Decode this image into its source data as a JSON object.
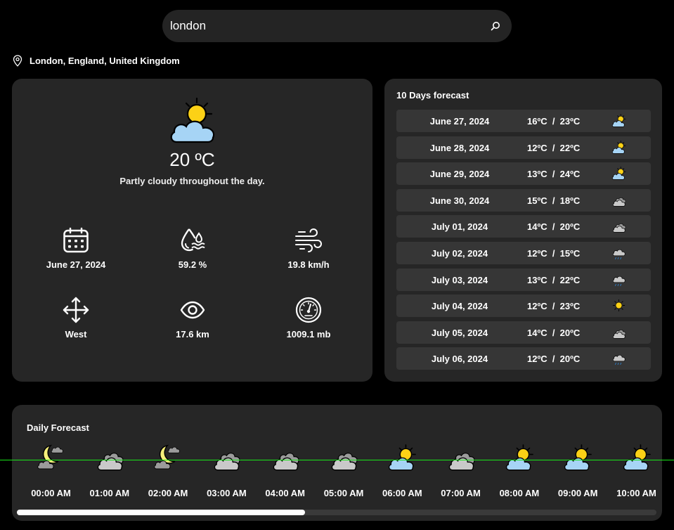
{
  "search": {
    "value": "london",
    "placeholder": ""
  },
  "location": "London, England, United Kingdom",
  "current": {
    "temp": "20 ºC",
    "summary": "Partly cloudy throughout the day.",
    "date": "June 27, 2024",
    "humidity": "59.2 %",
    "wind_speed": "19.8 km/h",
    "wind_dir": "West",
    "visibility": "17.6 km",
    "pressure": "1009.1 mb",
    "icon": "partly-cloudy-day-icon"
  },
  "ten_day": {
    "title": "10 Days forecast",
    "rows": [
      {
        "date": "June 27, 2024",
        "temps": "16ºC  /  23ºC",
        "icon": "partly-cloudy-day"
      },
      {
        "date": "June 28, 2024",
        "temps": "12ºC  /  22ºC",
        "icon": "partly-cloudy-day"
      },
      {
        "date": "June 29, 2024",
        "temps": "13ºC  /  24ºC",
        "icon": "partly-cloudy-day"
      },
      {
        "date": "June 30, 2024",
        "temps": "15ºC  /  18ºC",
        "icon": "cloudy"
      },
      {
        "date": "July 01, 2024",
        "temps": "14ºC  /  20ºC",
        "icon": "cloudy"
      },
      {
        "date": "July 02, 2024",
        "temps": "12ºC  /  15ºC",
        "icon": "rain"
      },
      {
        "date": "July 03, 2024",
        "temps": "13ºC  /  22ºC",
        "icon": "rain"
      },
      {
        "date": "July 04, 2024",
        "temps": "12ºC  /  23ºC",
        "icon": "clear-day"
      },
      {
        "date": "July 05, 2024",
        "temps": "14ºC  /  20ºC",
        "icon": "cloudy"
      },
      {
        "date": "July 06, 2024",
        "temps": "12ºC  /  20ºC",
        "icon": "rain"
      }
    ]
  },
  "daily": {
    "title": "Daily Forecast",
    "hours": [
      {
        "time": "00:00 AM",
        "icon": "partly-cloudy-night"
      },
      {
        "time": "01:00 AM",
        "icon": "cloudy"
      },
      {
        "time": "02:00 AM",
        "icon": "partly-cloudy-night"
      },
      {
        "time": "03:00 AM",
        "icon": "cloudy"
      },
      {
        "time": "04:00 AM",
        "icon": "cloudy"
      },
      {
        "time": "05:00 AM",
        "icon": "cloudy"
      },
      {
        "time": "06:00 AM",
        "icon": "partly-cloudy-day"
      },
      {
        "time": "07:00 AM",
        "icon": "cloudy"
      },
      {
        "time": "08:00 AM",
        "icon": "partly-cloudy-day"
      },
      {
        "time": "09:00 AM",
        "icon": "partly-cloudy-day"
      },
      {
        "time": "10:00 AM",
        "icon": "partly-cloudy-day"
      }
    ]
  },
  "scroll": {
    "position_fraction": 0.45
  },
  "colors": {
    "background": "#000000",
    "card": "#262626",
    "row": "#363636",
    "sun": "#fcd116",
    "cloud_day": "#a6d4f5",
    "cloud_grey": "#c9c9c9",
    "accent_line": "#19e619"
  }
}
